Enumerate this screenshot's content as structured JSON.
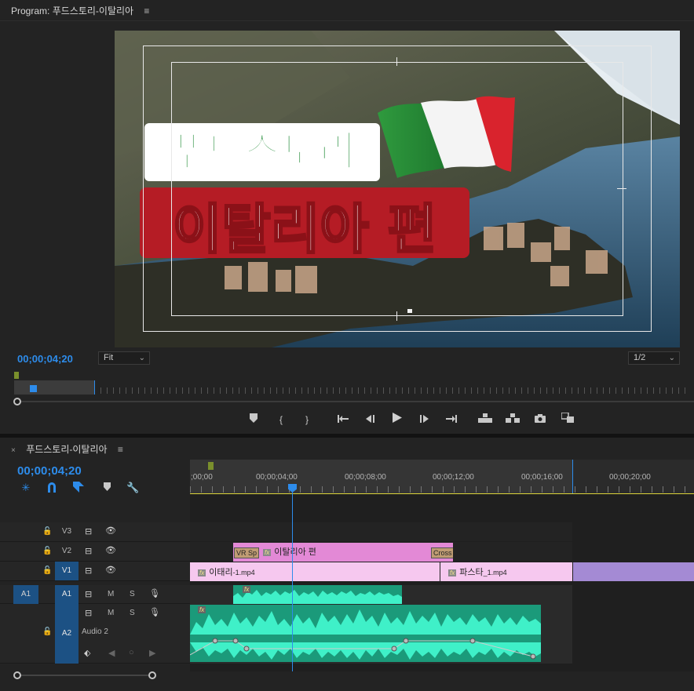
{
  "program": {
    "tab_label": "Program:",
    "sequence_name": "푸드스토리-이탈리아",
    "menu_icon": "≡",
    "overlay_line1": "푸드스토리",
    "overlay_line2": "이탈리아 편",
    "timecode": "00;00;04;20",
    "fit_value": "Fit",
    "resolution_value": "1/2"
  },
  "timeline": {
    "close_icon": "×",
    "sequence_name": "푸드스토리-이탈리아",
    "menu_icon": "≡",
    "timecode": "00;00;04;20",
    "ruler_labels": [
      ";00;00",
      "00;00;04;00",
      "00;00;08;00",
      "00;00;12;00",
      "00;00;16;00",
      "00;00;20;00"
    ],
    "tracks": {
      "v3": "V3",
      "v2": "V2",
      "v1": "V1",
      "a1": "A1",
      "a1_source": "A1",
      "a2": "A2",
      "a2_name": "Audio 2",
      "m": "M",
      "s": "S"
    },
    "clips": {
      "vr": "VR Sp",
      "title": "이탈리아 편",
      "cross": "Cross",
      "video1": "이태리",
      "video1_ext": "-1.mp4",
      "video2": "파스타",
      "video2_ext": "_1.mp4",
      "fx": "fx"
    }
  },
  "icons": {
    "marker": "marker-icon",
    "mark_in": "mark-in-icon",
    "mark_out": "mark-out-icon",
    "go_to_in": "go-to-in-icon",
    "step_back": "step-back-icon",
    "play": "play-icon",
    "step_forward": "step-forward-icon",
    "go_to_out": "go-to-out-icon",
    "lift": "lift-icon",
    "extract": "extract-icon",
    "export_frame": "camera-icon",
    "compare": "compare-icon"
  },
  "colors": {
    "accent_blue": "#2d8ceb",
    "title_clip": "#e389d6",
    "video_clip": "#f6c8ef",
    "audio_clip": "#1b9a7a",
    "waveform": "#3ff0c8",
    "work_area": "#dcd43a"
  }
}
